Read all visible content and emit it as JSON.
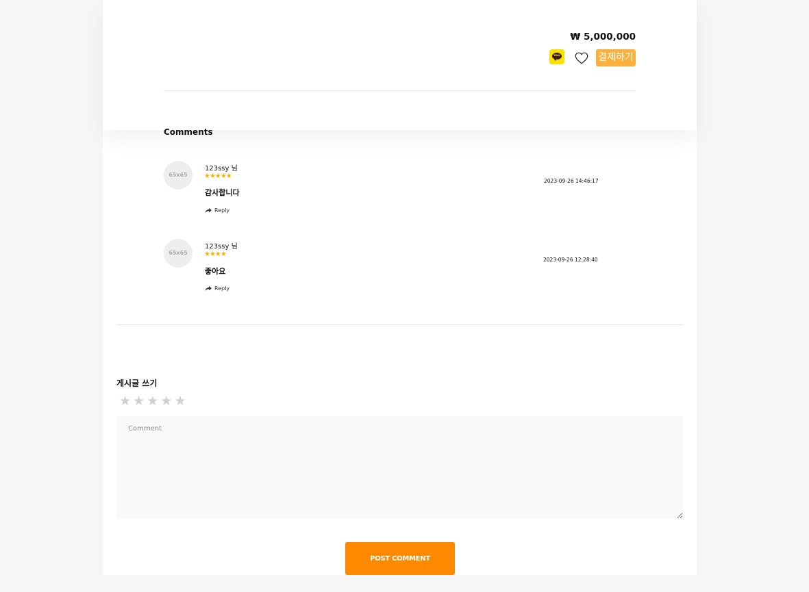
{
  "product": {
    "price": "₩ 5,000,000",
    "kakao_label": "TALK",
    "pay_button": "결제하기"
  },
  "comments_section": {
    "title": "Comments",
    "items": [
      {
        "avatar_placeholder": "65x65",
        "author": "123ssy 님",
        "rating": 5,
        "stars": "★★★★★",
        "text": "감사합니다",
        "date": "2023-09-26 14:46:17",
        "reply_label": "Reply"
      },
      {
        "avatar_placeholder": "65x65",
        "author": "123ssy 님",
        "rating": 4,
        "stars": "★★★★",
        "text": "좋아요",
        "date": "2023-09-26 12:28:40",
        "reply_label": "Reply"
      }
    ]
  },
  "write": {
    "title": "게시글 쓰기",
    "rating_stars": [
      "★",
      "★",
      "★",
      "★",
      "★"
    ],
    "rating_value": 0,
    "comment_placeholder": "Comment",
    "comment_value": "",
    "post_button": "POST COMMENT"
  },
  "colors": {
    "accent_orange": "#ff8a00",
    "pay_yellow": "#fbb03b",
    "kakao_yellow": "#fae100",
    "star_gold": "#f5b400",
    "star_empty": "#cfcfcf"
  }
}
